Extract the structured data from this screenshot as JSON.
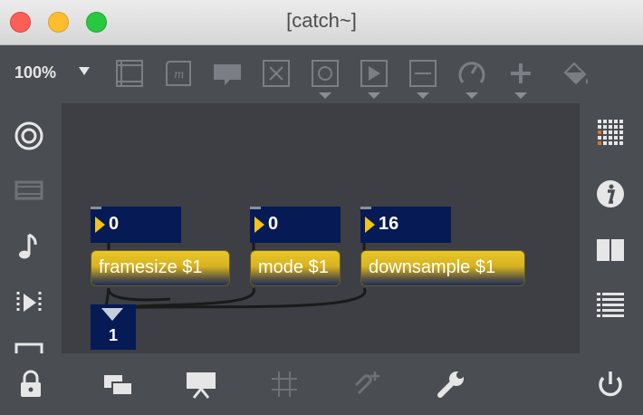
{
  "window": {
    "title": "[catch~]"
  },
  "toolbar": {
    "zoom": "100%",
    "icons": [
      "presentation-frame-icon",
      "comment-m-icon",
      "comment-bubble-icon",
      "toggle-x-icon",
      "button-circle-icon",
      "play-icon",
      "slider-icon",
      "dial-icon",
      "plus-icon",
      "paint-bucket-icon"
    ]
  },
  "patch": {
    "numboxes": [
      {
        "value": "0"
      },
      {
        "value": "0"
      },
      {
        "value": "16"
      }
    ],
    "messages": [
      {
        "text": "framesize $1"
      },
      {
        "text": "mode $1"
      },
      {
        "text": "downsample $1"
      }
    ],
    "output": {
      "value": "1"
    }
  },
  "colors": {
    "canvas": "#3d3f44",
    "chrome": "#4a4d52",
    "numbox": "#061a55",
    "message_gold": "#e9c628",
    "arrow_yellow": "#f2c418"
  }
}
